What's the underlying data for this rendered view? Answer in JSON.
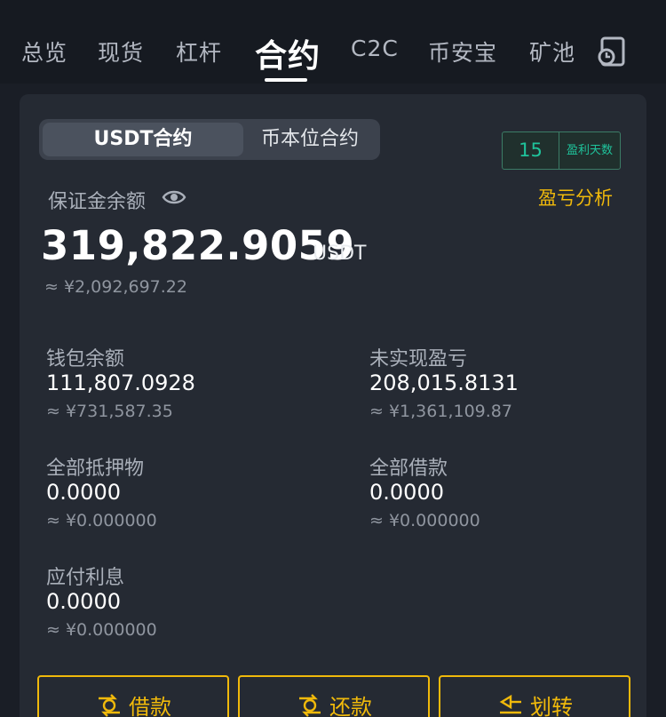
{
  "tabs": {
    "overview": "总览",
    "spot": "现货",
    "margin": "杠杆",
    "futures": "合约",
    "c2c": "C2C",
    "earn": "币安宝",
    "pool": "矿池"
  },
  "contract_type": {
    "usdt": "USDT合约",
    "coin": "币本位合约"
  },
  "profit_days": {
    "value": "15",
    "label": "盈利天数"
  },
  "balance": {
    "label": "保证金余额",
    "pnl_link": "盈亏分析",
    "value": "319,822.9059",
    "unit": "USDT",
    "cny": "≈ ¥2,092,697.22"
  },
  "stats": {
    "wallet": {
      "label": "钱包余额",
      "value": "111,807.0928",
      "cny": "≈ ¥731,587.35"
    },
    "unrealized": {
      "label": "未实现盈亏",
      "value": "208,015.8131",
      "cny": "≈ ¥1,361,109.87"
    },
    "collateral": {
      "label": "全部抵押物",
      "value": "0.0000",
      "cny": "≈ ¥0.000000"
    },
    "borrowed": {
      "label": "全部借款",
      "value": "0.0000",
      "cny": "≈ ¥0.000000"
    },
    "interest": {
      "label": "应付利息",
      "value": "0.0000",
      "cny": "≈ ¥0.000000"
    }
  },
  "actions": {
    "borrow": "借款",
    "repay": "还款",
    "transfer": "划转"
  },
  "colors": {
    "accent": "#f0b90b",
    "profit": "#1fc39b",
    "background": "#1a1e26",
    "card": "#252a33"
  }
}
